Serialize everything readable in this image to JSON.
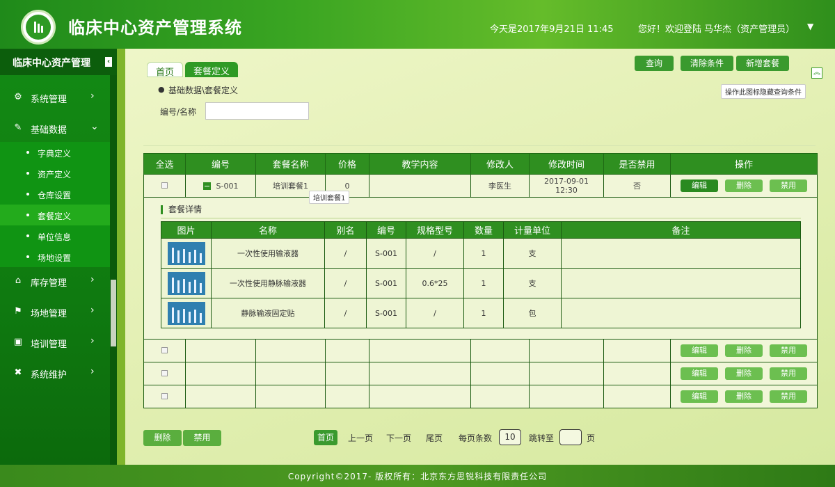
{
  "header": {
    "title": "临床中心资产管理系统",
    "date": "今天是2017年9月21日  11:45",
    "user": "您好！欢迎登陆  马华杰（资产管理员）",
    "caret": "▼"
  },
  "sidebar": {
    "title": "临床中心资产管理",
    "collapse": "‹",
    "items": [
      {
        "label": "系统管理",
        "icon": "gear-icon",
        "glyph": "⚙",
        "arrow": "›"
      },
      {
        "label": "基础数据",
        "icon": "edit-icon",
        "glyph": "✎",
        "arrow": "⌄"
      },
      {
        "label": "库存管理",
        "icon": "home-icon",
        "glyph": "⌂",
        "arrow": "›"
      },
      {
        "label": "场地管理",
        "icon": "flag-icon",
        "glyph": "⚑",
        "arrow": "›"
      },
      {
        "label": "培训管理",
        "icon": "board-icon",
        "glyph": "▣",
        "arrow": "›"
      },
      {
        "label": "系统维护",
        "icon": "tools-icon",
        "glyph": "✖",
        "arrow": "›"
      }
    ],
    "sub_items": [
      {
        "label": "字典定义"
      },
      {
        "label": "资产定义"
      },
      {
        "label": "仓库设置"
      },
      {
        "label": "套餐定义"
      },
      {
        "label": "单位信息"
      },
      {
        "label": "场地设置"
      }
    ]
  },
  "tabs": {
    "home": "首页",
    "current": "套餐定义"
  },
  "toolbar": {
    "query": "查询",
    "clear": "清除条件",
    "add": "新增套餐",
    "collapse_glyph": "︽",
    "collapse_tip": "操作此图标隐藏查询条件"
  },
  "breadcrumb": "基础数据\\套餐定义",
  "search": {
    "label": "编号/名称",
    "value": "",
    "placeholder": ""
  },
  "table": {
    "headers": [
      "全选",
      "编号",
      "套餐名称",
      "价格",
      "教学内容",
      "修改人",
      "修改时间",
      "是否禁用",
      "操作"
    ],
    "rows": [
      {
        "code": "S-001",
        "name": "培训套餐1",
        "price": "0",
        "content": "",
        "editor": "李医生",
        "time_date": "2017-09-01",
        "time_clock": "12:30",
        "disabled": "否"
      }
    ],
    "name_tooltip": "培训套餐1",
    "actions": {
      "edit": "编辑",
      "delete": "删除",
      "disable": "禁用"
    }
  },
  "detail": {
    "title": "套餐详情",
    "headers": [
      "图片",
      "名称",
      "别名",
      "编号",
      "规格型号",
      "数量",
      "计量单位",
      "备注"
    ],
    "rows": [
      {
        "name": "一次性使用输液器",
        "alias": "/",
        "code": "S-001",
        "spec": "/",
        "qty": "1",
        "unit": "支",
        "note": ""
      },
      {
        "name": "一次性使用静脉输液器",
        "alias": "/",
        "code": "S-001",
        "spec": "0.6*25",
        "qty": "1",
        "unit": "支",
        "note": ""
      },
      {
        "name": "静脉输液固定贴",
        "alias": "/",
        "code": "S-001",
        "spec": "/",
        "qty": "1",
        "unit": "包",
        "note": ""
      }
    ]
  },
  "bottom": {
    "delete": "删除",
    "disable": "禁用"
  },
  "pagination": {
    "first": "首页",
    "prev": "上一页",
    "next": "下一页",
    "last": "尾页",
    "per_page_label": "每页条数",
    "per_page": "10",
    "jump_label": "跳转至",
    "jump_value": "",
    "page_suffix": "页"
  },
  "footer": "Copyright©2017- 版权所有：北京东方思锐科技有限责任公司",
  "colors": {
    "brand": "#2f8f20",
    "accent": "#6cbf50",
    "sidebar": "#0f7a10"
  }
}
